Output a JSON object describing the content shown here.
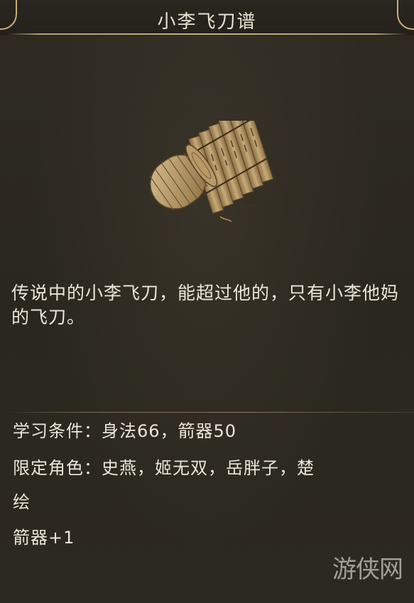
{
  "item": {
    "title": "小李飞刀谱",
    "icon": "bamboo-scroll-icon",
    "description": "传说中的小李飞刀，能超过他的，只有小李他妈的飞刀。"
  },
  "stats": {
    "requirement": "学习条件：身法66，箭器50",
    "restricted_roles_line1": "限定角色：史燕，姬无双，岳胖子，楚",
    "restricted_roles_line2": "绘",
    "bonus": "箭器+1"
  },
  "watermark": "游侠网",
  "colors": {
    "background": "#2b2820",
    "text": "#ece6d8",
    "gold_trim": "#c7ad7b"
  }
}
